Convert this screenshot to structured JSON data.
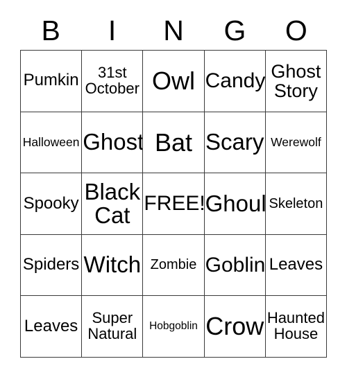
{
  "header": {
    "letters": [
      "B",
      "I",
      "N",
      "G",
      "O"
    ]
  },
  "grid": {
    "rows": [
      [
        {
          "text": "Pumkin",
          "size": "fs-ml"
        },
        {
          "text": "31st\nOctober",
          "size": "fs-m"
        },
        {
          "text": "Owl",
          "size": "fs-huge"
        },
        {
          "text": "Candy",
          "size": "fs-xl"
        },
        {
          "text": "Ghost\nStory",
          "size": "fs-l"
        }
      ],
      [
        {
          "text": "Halloween",
          "size": "fs-s"
        },
        {
          "text": "Ghost",
          "size": "fs-xxl"
        },
        {
          "text": "Bat",
          "size": "fs-huge"
        },
        {
          "text": "Scary",
          "size": "fs-xxl"
        },
        {
          "text": "Werewolf",
          "size": "fs-s"
        }
      ],
      [
        {
          "text": "Spooky",
          "size": "fs-ml"
        },
        {
          "text": "Black\nCat",
          "size": "fs-xxl"
        },
        {
          "text": "FREE!",
          "size": "fs-xl"
        },
        {
          "text": "Ghoul",
          "size": "fs-xxl"
        },
        {
          "text": "Skeleton",
          "size": "fs-sm"
        }
      ],
      [
        {
          "text": "Spiders",
          "size": "fs-ml"
        },
        {
          "text": "Witch",
          "size": "fs-xxl"
        },
        {
          "text": "Zombie",
          "size": "fs-sm"
        },
        {
          "text": "Goblin",
          "size": "fs-xl"
        },
        {
          "text": "Leaves",
          "size": "fs-ml"
        }
      ],
      [
        {
          "text": "Leaves",
          "size": "fs-ml"
        },
        {
          "text": "Super\nNatural",
          "size": "fs-m"
        },
        {
          "text": "Hobgoblin",
          "size": "fs-xs"
        },
        {
          "text": "Crow",
          "size": "fs-huge"
        },
        {
          "text": "Haunted\nHouse",
          "size": "fs-m"
        }
      ]
    ]
  },
  "colors": {
    "border": "#3a3a3a",
    "text": "#000000",
    "background": "#ffffff"
  }
}
